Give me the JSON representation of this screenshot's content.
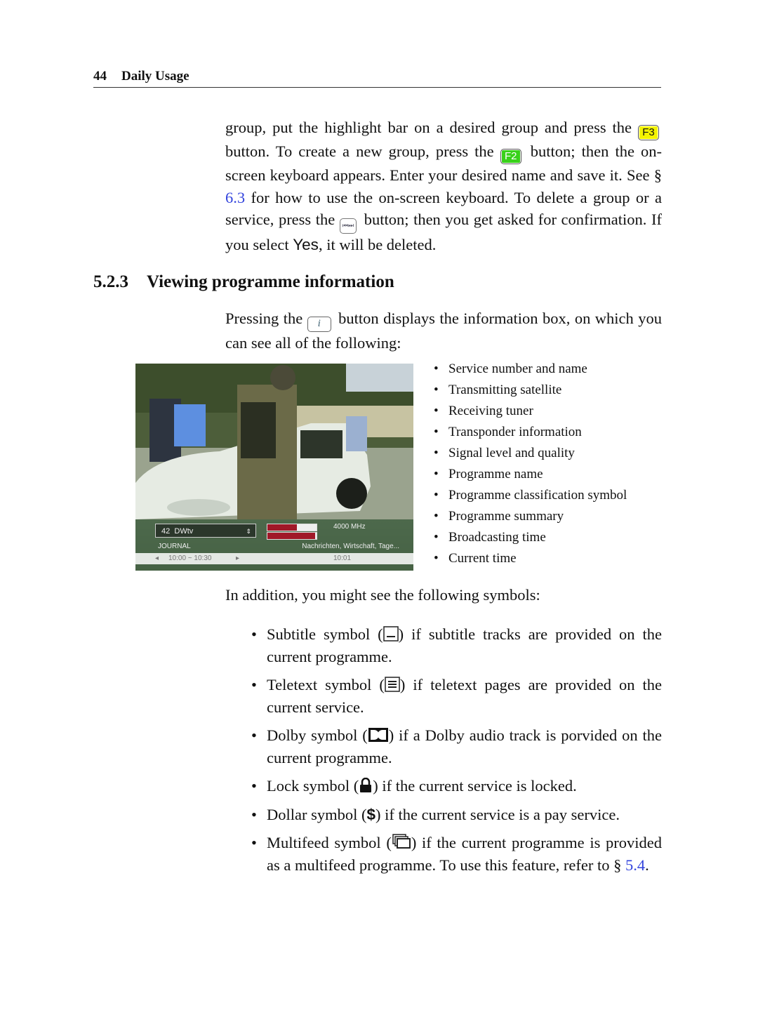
{
  "header": {
    "page_number": "44",
    "chapter": "Daily Usage"
  },
  "intro_paragraph": {
    "t1": "group, put the highlight bar on a desired group and press the ",
    "key_f3": "F3",
    "t2": " button. To create a new group, press the ",
    "key_f2": "F2",
    "t3": " button; then the on-screen keyboard appears. Enter your desired name and save it. See § ",
    "link_6_3": "6.3",
    "t4": " for how to use the on-screen keyboard. To delete a group or a service, press the ",
    "key_skip": "⏮⏭",
    "t5": " button; then you get asked for confirmation. If you select ",
    "yes_label": "Yes",
    "t6": ", it will be deleted."
  },
  "section": {
    "number": "5.2.3",
    "title": "Viewing programme information"
  },
  "info_paragraph": {
    "t1": "Pressing the ",
    "key_info": "i",
    "t2": " button displays the information box, on which you can see all of the following:"
  },
  "tv_screenshot": {
    "service_number": "42",
    "service_name": "DWtv",
    "updown_arrows": "⇕",
    "signal_level": 0.6,
    "signal_quality": 0.97,
    "frequency": "4000 MHz",
    "programme_name": "JOURNAL",
    "programme_summary": "Nachrichten, Wirtschaft, Tage...",
    "prev_arrow": "◂",
    "broadcast_time": "10:00 ~ 10:30",
    "next_arrow": "▸",
    "current_time": "10:01"
  },
  "info_items": [
    "Service number and name",
    "Transmitting satellite",
    "Receiving tuner",
    "Transponder information",
    "Signal level and quality",
    "Programme name",
    "Programme classification symbol",
    "Programme summary",
    "Broadcasting time",
    "Current time"
  ],
  "symbols_intro": "In addition, you might see the following symbols:",
  "symbols": [
    {
      "label": "Subtitle symbol (",
      "after": ") if subtitle tracks are provided on the current programme."
    },
    {
      "label": "Teletext symbol (",
      "after": ") if teletext pages are provided on the current service."
    },
    {
      "label": "Dolby symbol (",
      "after": ") if a Dolby audio track is porvided on the current programme."
    },
    {
      "label": "Lock symbol (",
      "after": ") if the current service is locked."
    },
    {
      "label": "Dollar symbol (",
      "glyph": "$",
      "after": ") if the current service is a pay service."
    },
    {
      "label": "Multifeed symbol (",
      "after": ") if the current programme is provided as a multifeed programme. To use this feature, refer to § ",
      "link": "5.4",
      "end": "."
    }
  ]
}
